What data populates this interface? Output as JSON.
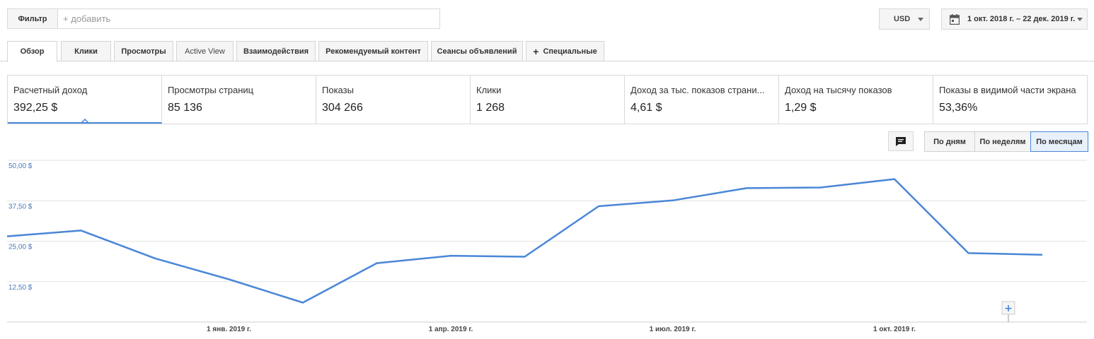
{
  "filter": {
    "label": "Фильтр",
    "placeholder": "+ добавить"
  },
  "currency": {
    "value": "USD"
  },
  "date_range": {
    "value": "1 окт. 2018 г. – 22 дек. 2019 г."
  },
  "tabs": [
    {
      "label": "Обзор"
    },
    {
      "label": "Клики"
    },
    {
      "label": "Просмотры"
    },
    {
      "label": "Active View"
    },
    {
      "label": "Взаимодействия"
    },
    {
      "label": "Рекомендуемый контент"
    },
    {
      "label": "Сеансы объявлений"
    },
    {
      "label": "Специальные"
    }
  ],
  "scorecards": [
    {
      "label": "Расчетный доход",
      "value": "392,25 $"
    },
    {
      "label": "Просмотры страниц",
      "value": "85 136"
    },
    {
      "label": "Показы",
      "value": "304 266"
    },
    {
      "label": "Клики",
      "value": "1 268"
    },
    {
      "label": "Доход за тыс. показов страни...",
      "value": "4,61 $"
    },
    {
      "label": "Доход на тысячу показов",
      "value": "1,29 $"
    },
    {
      "label": "Показы в видимой части экрана",
      "value": "53,36%"
    }
  ],
  "granularity": [
    {
      "label": "По дням"
    },
    {
      "label": "По неделям"
    },
    {
      "label": "По месяцам"
    }
  ],
  "icons": {
    "comment": "comment-icon",
    "calendar": "calendar-icon",
    "add_annotation": "plus-icon"
  },
  "colors": {
    "series": "#4a86d8",
    "active_tab_border": "#4a86d8"
  },
  "chart_data": {
    "type": "line",
    "x": [
      "2018-10",
      "2018-11",
      "2018-12",
      "2019-01",
      "2019-02",
      "2019-03",
      "2019-04",
      "2019-05",
      "2019-06",
      "2019-07",
      "2019-08",
      "2019-09",
      "2019-10",
      "2019-11",
      "2019-12"
    ],
    "series": [
      {
        "values": [
          26.5,
          28.3,
          19.7,
          13.2,
          6.0,
          18.2,
          20.5,
          20.2,
          35.8,
          37.6,
          41.4,
          41.6,
          44.2,
          21.3,
          20.8
        ]
      }
    ],
    "y_ticks": [
      "50,00 $",
      "37,50 $",
      "25,00 $",
      "12,50 $"
    ],
    "y_tick_values": [
      50,
      37.5,
      25,
      12.5
    ],
    "x_tick_labels": [
      "1 янв. 2019 г.",
      "1 апр. 2019 г.",
      "1 июл. 2019 г.",
      "1 окт. 2019 г."
    ],
    "x_tick_positions": [
      "2019-01",
      "2019-04",
      "2019-07",
      "2019-10"
    ],
    "ylim": [
      0,
      50
    ],
    "grid": true
  }
}
